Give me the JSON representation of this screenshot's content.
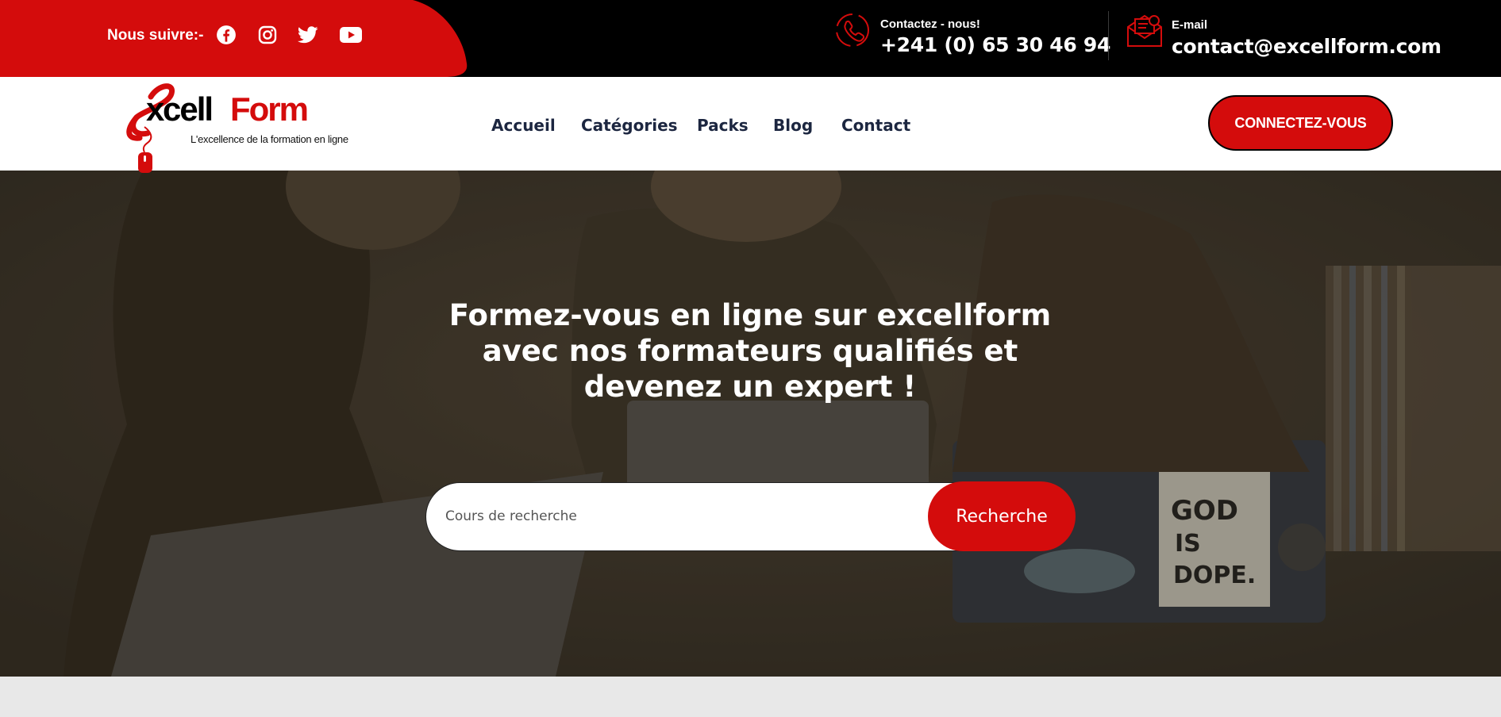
{
  "topbar": {
    "follow_label": "Nous suivre:-",
    "social_icons": [
      "facebook-icon",
      "instagram-icon",
      "twitter-icon",
      "youtube-icon"
    ],
    "phone": {
      "label": "Contactez - nous!",
      "value": "+241 (0) 65 30 46 94"
    },
    "email": {
      "label": "E-mail",
      "value": "contact@excellform.com"
    }
  },
  "brand": {
    "tagline": "L'excellence de la formation en ligne"
  },
  "nav": {
    "items": [
      "Accueil",
      "Catégories",
      "Packs",
      "Blog",
      "Contact"
    ],
    "login_label": "CONNECTEZ-VOUS"
  },
  "hero": {
    "title_part1": "Formez-vous en ligne sur ",
    "title_bold": "excellform",
    "title_part2": " avec nos formateurs qualifiés et devenez un expert !",
    "search_placeholder": "Cours de recherche",
    "search_button": "Recherche"
  },
  "colors": {
    "accent_red": "#d40c0c",
    "topbar_black": "#000000",
    "nav_text": "#1c2640"
  }
}
